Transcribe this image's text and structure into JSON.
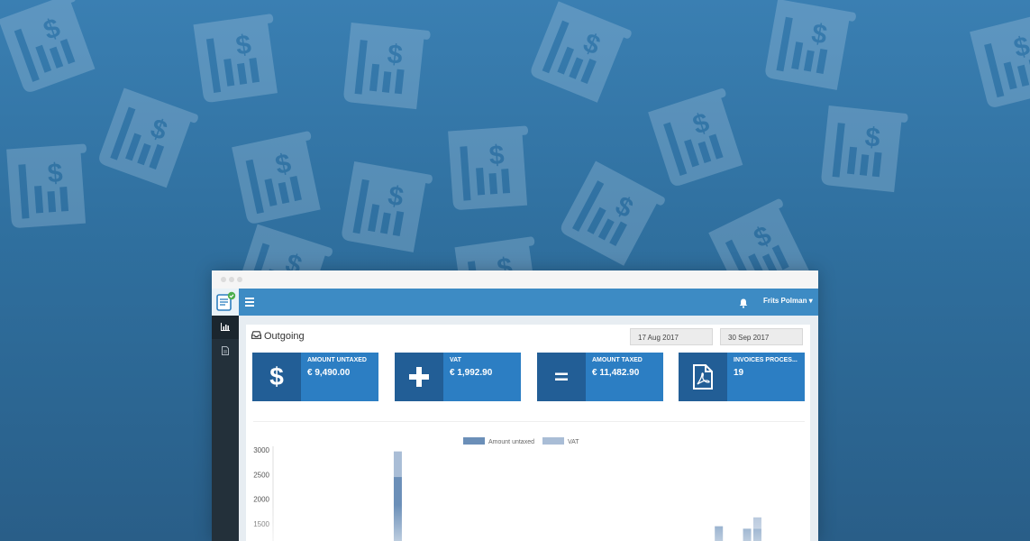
{
  "background": {
    "color_top": "#3a7fb2",
    "color_bottom": "#295e88",
    "pattern_icon": "invoice-dollar-icon"
  },
  "app": {
    "logo": "invoice-app-logo-icon",
    "menu_icon": "hamburger-menu-icon",
    "notification_icon": "bell-icon",
    "user_name": "Frits Polman",
    "user_caret": "▾"
  },
  "sidebar": {
    "items": [
      {
        "icon": "bar-chart-icon",
        "active": true
      },
      {
        "icon": "document-icon",
        "active": false
      }
    ]
  },
  "main": {
    "title": "Outgoing",
    "title_icon": "inbox-tray-icon",
    "date_from": "17 Aug 2017",
    "date_to": "30 Sep 2017",
    "cards": [
      {
        "label": "AMOUNT UNTAXED",
        "value": "€ 9,490.00",
        "icon": "dollar-sign-icon"
      },
      {
        "label": "VAT",
        "value": "€ 1,992.90",
        "icon": "plus-icon"
      },
      {
        "label": "AMOUNT TAXED",
        "value": "€ 11,482.90",
        "icon": "equals-icon"
      },
      {
        "label": "INVOICES PROCES...",
        "value": "19",
        "icon": "pdf-file-icon"
      }
    ],
    "accent_color": "#2c7ec3",
    "topbar_color": "#3d8bc4"
  },
  "chart_data": {
    "type": "bar",
    "stacked": true,
    "series": [
      {
        "name": "Amount untaxed",
        "color": "#6b8fb8"
      },
      {
        "name": "VAT",
        "color": "#a9bdd6"
      }
    ],
    "legend": [
      "Amount untaxed",
      "VAT"
    ],
    "legend_position": "top-center",
    "y_ticks": [
      3000,
      2500,
      2000,
      1500
    ],
    "ylim": [
      1500,
      3000
    ],
    "bars": [
      {
        "x_index": 0.235,
        "untaxed": 2450,
        "vat": 2970
      },
      {
        "x_index": 0.86,
        "untaxed": 1450,
        "vat": 1450
      },
      {
        "x_index": 0.915,
        "untaxed": 1400,
        "vat": 1400
      },
      {
        "x_index": 0.935,
        "untaxed": 1400,
        "vat": 1630
      }
    ]
  }
}
